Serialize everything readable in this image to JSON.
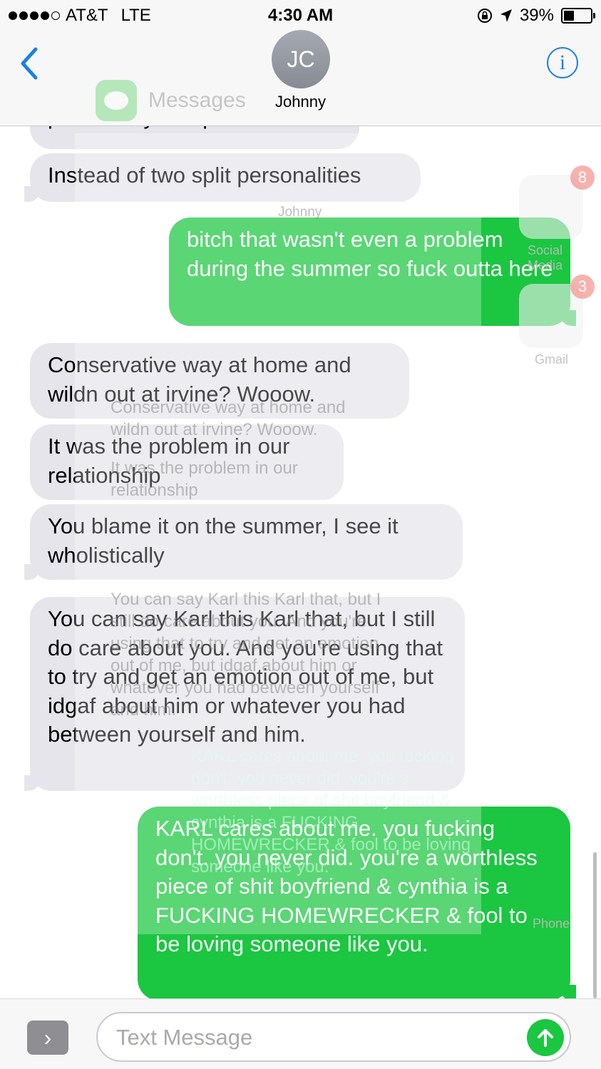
{
  "status_bar": {
    "carrier": "AT&T",
    "network": "LTE",
    "time": "4:30 AM",
    "battery": "39%",
    "battery_level": 0.39,
    "signal_bars": 4
  },
  "nav": {
    "back_icon": "chevron-left-icon",
    "avatar_initials": "JC",
    "contact_name": "Johnny",
    "app_switch_label": "Messages",
    "info_glyph": "i"
  },
  "messages": [
    {
      "from": "them",
      "text": "personality in a person?"
    },
    {
      "from": "them",
      "text": "Instead of two split personalities"
    },
    {
      "from": "me",
      "text": "bitch that wasn't even a problem during the summer so fuck outta here"
    },
    {
      "from": "them",
      "text": "Conservative way at home and wildn out at irvine? Wooow."
    },
    {
      "from": "them",
      "text": "It was the problem in our relationship"
    },
    {
      "from": "them",
      "text": "You blame it on the summer, I see it wholistically"
    },
    {
      "from": "them",
      "text": "You can say Karl this Karl that, but I still do care about you. And you're using that to try and get an emotion out of me, but idgaf about him or whatever you had between yourself and him."
    },
    {
      "from": "me",
      "text": "KARL cares about me. you fucking don't. you never did. you're a worthless piece of shit boyfriend & cynthia is a FUCKING HOMEWRECKER & fool to be loving someone like you."
    }
  ],
  "ghost": {
    "apps": [
      {
        "label": "Social Media",
        "badge": "8"
      },
      {
        "label": "Gmail",
        "badge": "3"
      },
      {
        "label": "Phone",
        "badge": ""
      }
    ]
  },
  "composer": {
    "placeholder": "Text Message",
    "expand_glyph": "›"
  },
  "colors": {
    "outgoing": "#1bc641",
    "incoming": "#e6e5eb",
    "accent": "#1a7ee8"
  }
}
